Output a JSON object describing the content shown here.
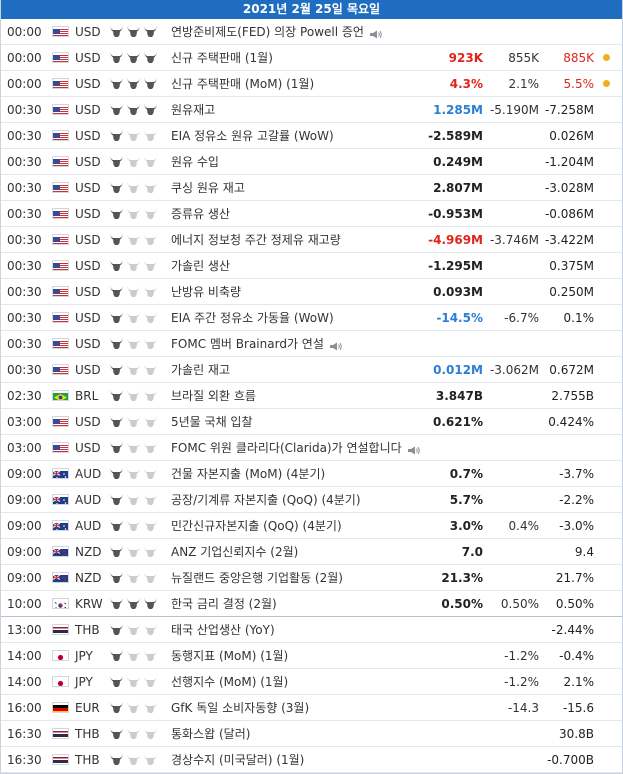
{
  "header": {
    "date": "2021년 2월 25일 목요일"
  },
  "colors": {
    "header_bg": "#1f6dc0",
    "red": "#e0251b",
    "blue": "#2b7fd4",
    "bull_on": "#555555",
    "bull_off": "#c9ccd0",
    "dot": "#f0b01e"
  },
  "rows": [
    {
      "time": "00:00",
      "flag": "us",
      "currency": "USD",
      "importance": 3,
      "event": "연방준비제도(FED) 의장 Powell 증언",
      "speech": true,
      "actual": "",
      "actual_color": "black",
      "forecast": "",
      "previous": "",
      "previous_color": "black",
      "dot": false
    },
    {
      "time": "00:00",
      "flag": "us",
      "currency": "USD",
      "importance": 3,
      "event": "신규 주택판매 (1월)",
      "speech": false,
      "actual": "923K",
      "actual_color": "red",
      "forecast": "855K",
      "previous": "885K",
      "previous_color": "red",
      "dot": true
    },
    {
      "time": "00:00",
      "flag": "us",
      "currency": "USD",
      "importance": 3,
      "event": "신규 주택판매 (MoM) (1월)",
      "speech": false,
      "actual": "4.3%",
      "actual_color": "red",
      "forecast": "2.1%",
      "previous": "5.5%",
      "previous_color": "red",
      "dot": true
    },
    {
      "time": "00:30",
      "flag": "us",
      "currency": "USD",
      "importance": 3,
      "event": "원유재고",
      "speech": false,
      "actual": "1.285M",
      "actual_color": "blue",
      "forecast": "-5.190M",
      "previous": "-7.258M",
      "previous_color": "black",
      "dot": false
    },
    {
      "time": "00:30",
      "flag": "us",
      "currency": "USD",
      "importance": 1,
      "event": "EIA 정유소 원유 고갈률 (WoW)",
      "speech": false,
      "actual": "-2.589M",
      "actual_color": "black",
      "forecast": "",
      "previous": "0.026M",
      "previous_color": "black",
      "dot": false
    },
    {
      "time": "00:30",
      "flag": "us",
      "currency": "USD",
      "importance": 1,
      "event": "원유 수입",
      "speech": false,
      "actual": "0.249M",
      "actual_color": "black",
      "forecast": "",
      "previous": "-1.204M",
      "previous_color": "black",
      "dot": false
    },
    {
      "time": "00:30",
      "flag": "us",
      "currency": "USD",
      "importance": 1,
      "event": "쿠싱 원유 재고",
      "speech": false,
      "actual": "2.807M",
      "actual_color": "black",
      "forecast": "",
      "previous": "-3.028M",
      "previous_color": "black",
      "dot": false
    },
    {
      "time": "00:30",
      "flag": "us",
      "currency": "USD",
      "importance": 1,
      "event": "증류유 생산",
      "speech": false,
      "actual": "-0.953M",
      "actual_color": "black",
      "forecast": "",
      "previous": "-0.086M",
      "previous_color": "black",
      "dot": false
    },
    {
      "time": "00:30",
      "flag": "us",
      "currency": "USD",
      "importance": 1,
      "event": "에너지 정보청 주간 정제유 재고량",
      "speech": false,
      "actual": "-4.969M",
      "actual_color": "red",
      "forecast": "-3.746M",
      "previous": "-3.422M",
      "previous_color": "black",
      "dot": false
    },
    {
      "time": "00:30",
      "flag": "us",
      "currency": "USD",
      "importance": 1,
      "event": "가솔린 생산",
      "speech": false,
      "actual": "-1.295M",
      "actual_color": "black",
      "forecast": "",
      "previous": "0.375M",
      "previous_color": "black",
      "dot": false
    },
    {
      "time": "00:30",
      "flag": "us",
      "currency": "USD",
      "importance": 1,
      "event": "난방유 비축량",
      "speech": false,
      "actual": "0.093M",
      "actual_color": "black",
      "forecast": "",
      "previous": "0.250M",
      "previous_color": "black",
      "dot": false
    },
    {
      "time": "00:30",
      "flag": "us",
      "currency": "USD",
      "importance": 1,
      "event": "EIA 주간 정유소 가동율 (WoW)",
      "speech": false,
      "actual": "-14.5%",
      "actual_color": "blue",
      "forecast": "-6.7%",
      "previous": "0.1%",
      "previous_color": "black",
      "dot": false
    },
    {
      "time": "00:30",
      "flag": "us",
      "currency": "USD",
      "importance": 1,
      "event": "FOMC 멤버 Brainard가 연설",
      "speech": true,
      "actual": "",
      "actual_color": "black",
      "forecast": "",
      "previous": "",
      "previous_color": "black",
      "dot": false
    },
    {
      "time": "00:30",
      "flag": "us",
      "currency": "USD",
      "importance": 1,
      "event": "가솔린 재고",
      "speech": false,
      "actual": "0.012M",
      "actual_color": "blue",
      "forecast": "-3.062M",
      "previous": "0.672M",
      "previous_color": "black",
      "dot": false
    },
    {
      "time": "02:30",
      "flag": "br",
      "currency": "BRL",
      "importance": 1,
      "event": "브라질 외환 흐름",
      "speech": false,
      "actual": "3.847B",
      "actual_color": "black",
      "forecast": "",
      "previous": "2.755B",
      "previous_color": "black",
      "dot": false
    },
    {
      "time": "03:00",
      "flag": "us",
      "currency": "USD",
      "importance": 1,
      "event": "5년물 국채 입찰",
      "speech": false,
      "actual": "0.621%",
      "actual_color": "black",
      "forecast": "",
      "previous": "0.424%",
      "previous_color": "black",
      "dot": false
    },
    {
      "time": "03:00",
      "flag": "us",
      "currency": "USD",
      "importance": 1,
      "event": "FOMC 위원 클라리다(Clarida)가 연설합니다",
      "speech": true,
      "actual": "",
      "actual_color": "black",
      "forecast": "",
      "previous": "",
      "previous_color": "black",
      "dot": false
    },
    {
      "time": "09:00",
      "flag": "au",
      "currency": "AUD",
      "importance": 1,
      "event": "건물 자본지출 (MoM) (4분기)",
      "speech": false,
      "actual": "0.7%",
      "actual_color": "black",
      "forecast": "",
      "previous": "-3.7%",
      "previous_color": "black",
      "dot": false
    },
    {
      "time": "09:00",
      "flag": "au",
      "currency": "AUD",
      "importance": 1,
      "event": "공장/기계류 자본지출 (QoQ) (4분기)",
      "speech": false,
      "actual": "5.7%",
      "actual_color": "black",
      "forecast": "",
      "previous": "-2.2%",
      "previous_color": "black",
      "dot": false
    },
    {
      "time": "09:00",
      "flag": "au",
      "currency": "AUD",
      "importance": 1,
      "event": "민간신규자본지출 (QoQ) (4분기)",
      "speech": false,
      "actual": "3.0%",
      "actual_color": "black",
      "forecast": "0.4%",
      "previous": "-3.0%",
      "previous_color": "black",
      "dot": false
    },
    {
      "time": "09:00",
      "flag": "nz",
      "currency": "NZD",
      "importance": 1,
      "event": "ANZ 기업신뢰지수 (2월)",
      "speech": false,
      "actual": "7.0",
      "actual_color": "black",
      "forecast": "",
      "previous": "9.4",
      "previous_color": "black",
      "dot": false
    },
    {
      "time": "09:00",
      "flag": "nz",
      "currency": "NZD",
      "importance": 1,
      "event": "뉴질랜드 중앙은행 기업활동 (2월)",
      "speech": false,
      "actual": "21.3%",
      "actual_color": "black",
      "forecast": "",
      "previous": "21.7%",
      "previous_color": "black",
      "dot": false
    },
    {
      "time": "10:00",
      "flag": "kr",
      "currency": "KRW",
      "importance": 3,
      "event": "한국 금리 결정 (2월)",
      "speech": false,
      "actual": "0.50%",
      "actual_color": "black",
      "forecast": "0.50%",
      "previous": "0.50%",
      "previous_color": "black",
      "dot": false,
      "sep": true
    },
    {
      "time": "13:00",
      "flag": "th",
      "currency": "THB",
      "importance": 1,
      "event": "태국 산업생산 (YoY)",
      "speech": false,
      "actual": "",
      "actual_color": "black",
      "forecast": "",
      "previous": "-2.44%",
      "previous_color": "black",
      "dot": false
    },
    {
      "time": "14:00",
      "flag": "jp",
      "currency": "JPY",
      "importance": 1,
      "event": "동행지표 (MoM) (1월)",
      "speech": false,
      "actual": "",
      "actual_color": "black",
      "forecast": "-1.2%",
      "previous": "-0.4%",
      "previous_color": "black",
      "dot": false
    },
    {
      "time": "14:00",
      "flag": "jp",
      "currency": "JPY",
      "importance": 1,
      "event": "선행지수 (MoM) (1월)",
      "speech": false,
      "actual": "",
      "actual_color": "black",
      "forecast": "-1.2%",
      "previous": "2.1%",
      "previous_color": "black",
      "dot": false
    },
    {
      "time": "16:00",
      "flag": "de",
      "currency": "EUR",
      "importance": 1,
      "event": "GfK 독일 소비자동향 (3월)",
      "speech": false,
      "actual": "",
      "actual_color": "black",
      "forecast": "-14.3",
      "previous": "-15.6",
      "previous_color": "black",
      "dot": false
    },
    {
      "time": "16:30",
      "flag": "th",
      "currency": "THB",
      "importance": 1,
      "event": "통화스왑 (달러)",
      "speech": false,
      "actual": "",
      "actual_color": "black",
      "forecast": "",
      "previous": "30.8B",
      "previous_color": "black",
      "dot": false
    },
    {
      "time": "16:30",
      "flag": "th",
      "currency": "THB",
      "importance": 1,
      "event": "경상수지 (미국달러) (1월)",
      "speech": false,
      "actual": "",
      "actual_color": "black",
      "forecast": "",
      "previous": "-0.700B",
      "previous_color": "black",
      "dot": false
    }
  ]
}
